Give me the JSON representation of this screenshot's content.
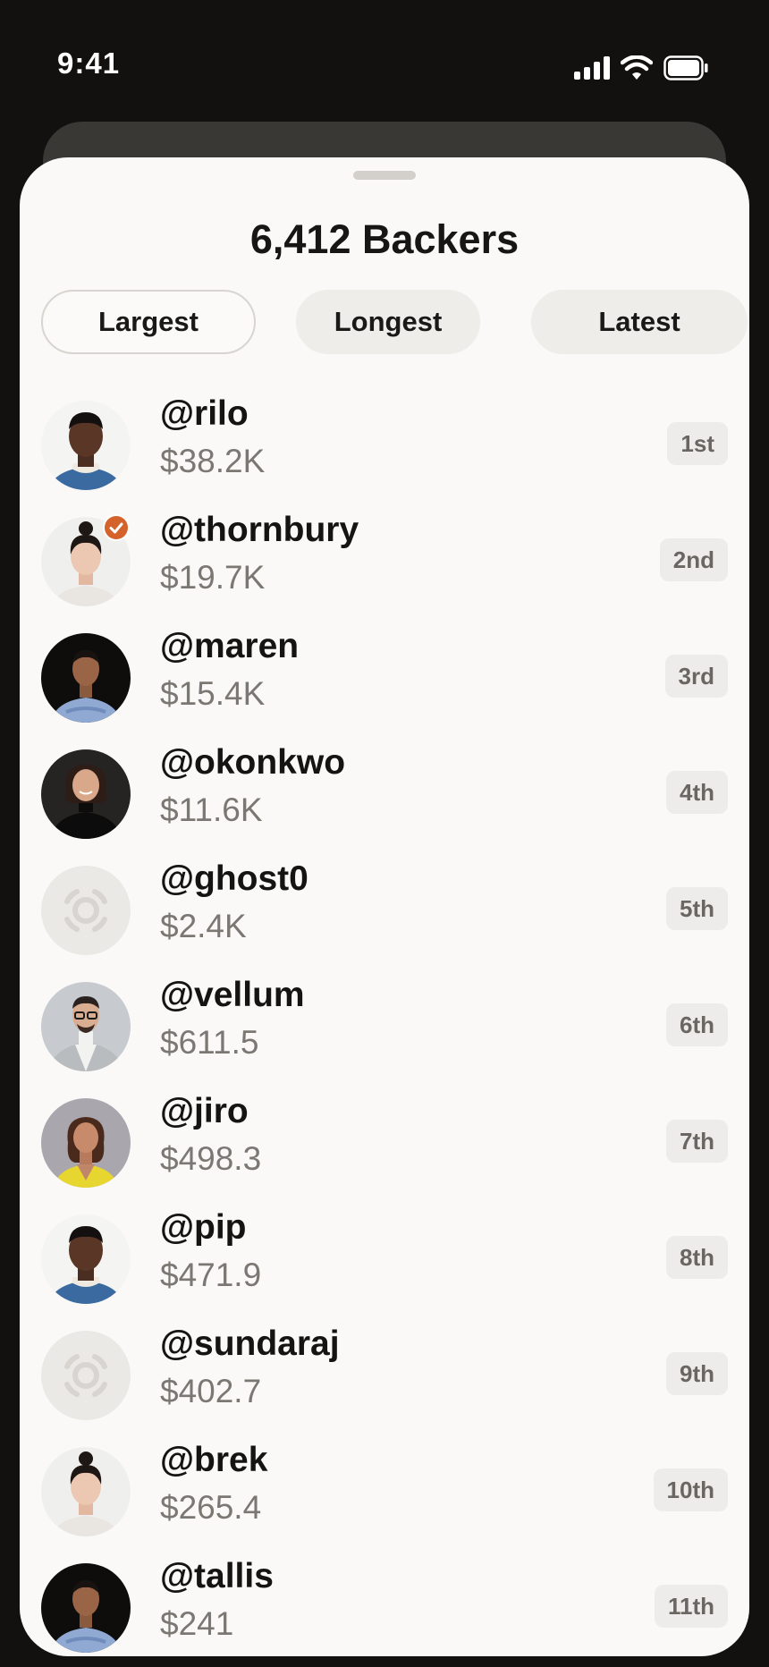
{
  "status_bar": {
    "time": "9:41"
  },
  "sheet": {
    "title": "6,412 Backers"
  },
  "tabs": [
    {
      "label": "Largest",
      "active": true
    },
    {
      "label": "Longest",
      "active": false
    },
    {
      "label": "Latest",
      "active": false
    }
  ],
  "backers": [
    {
      "handle": "@rilo",
      "amount": "$38.2K",
      "rank": "1st",
      "avatar": "photo-man-white-turtleneck",
      "verified": false
    },
    {
      "handle": "@thornbury",
      "amount": "$19.7K",
      "rank": "2nd",
      "avatar": "photo-woman-bun",
      "verified": true
    },
    {
      "handle": "@maren",
      "amount": "$15.4K",
      "rank": "3rd",
      "avatar": "photo-man-blue-shirt-dark-bg",
      "verified": false
    },
    {
      "handle": "@okonkwo",
      "amount": "$11.6K",
      "rank": "4th",
      "avatar": "photo-woman-black-turtleneck",
      "verified": false
    },
    {
      "handle": "@ghost0",
      "amount": "$2.4K",
      "rank": "5th",
      "avatar": "placeholder-avatar-icon",
      "verified": false
    },
    {
      "handle": "@vellum",
      "amount": "$611.5",
      "rank": "6th",
      "avatar": "photo-man-glasses-grey-blazer",
      "verified": false
    },
    {
      "handle": "@jiro",
      "amount": "$498.3",
      "rank": "7th",
      "avatar": "photo-woman-yellow-jacket",
      "verified": false
    },
    {
      "handle": "@pip",
      "amount": "$471.9",
      "rank": "8th",
      "avatar": "photo-man-white-turtleneck",
      "verified": false
    },
    {
      "handle": "@sundaraj",
      "amount": "$402.7",
      "rank": "9th",
      "avatar": "placeholder-avatar-icon",
      "verified": false
    },
    {
      "handle": "@brek",
      "amount": "$265.4",
      "rank": "10th",
      "avatar": "photo-woman-bun",
      "verified": false
    },
    {
      "handle": "@tallis",
      "amount": "$241",
      "rank": "11th",
      "avatar": "photo-man-blue-shirt-dark-bg",
      "verified": false
    }
  ],
  "colors": {
    "background": "#121110",
    "sheet": "#faf9f7",
    "verified_badge": "#d4622a",
    "rank_chip": "#eeecea",
    "amount_text": "#7b7873"
  }
}
